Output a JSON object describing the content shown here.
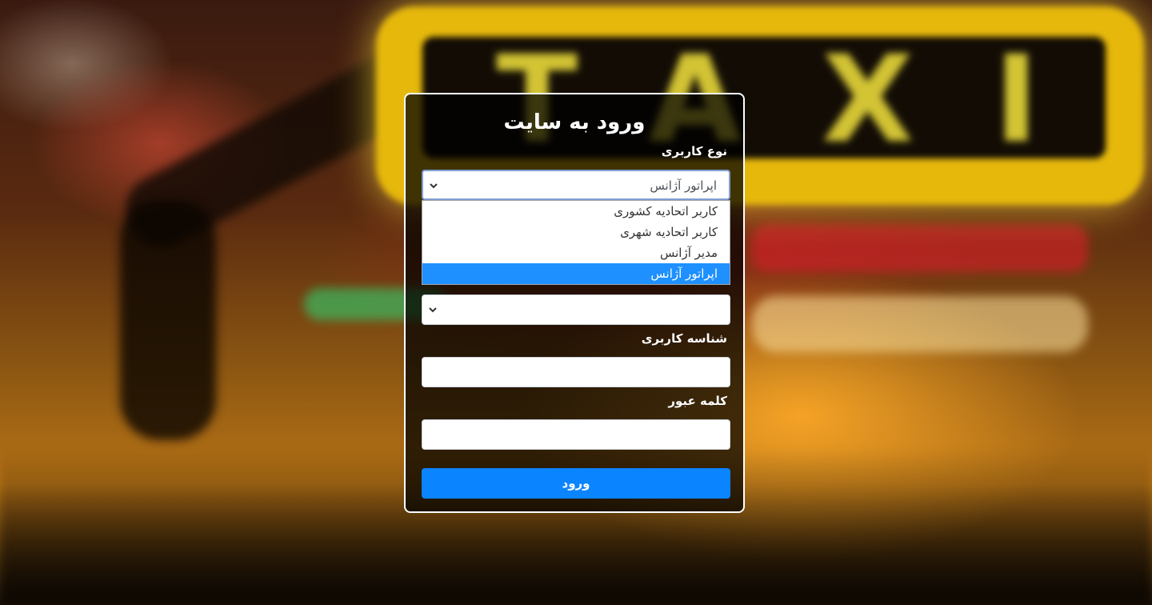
{
  "background": {
    "sign_text": "TAXI"
  },
  "login": {
    "title": "ورود به سایت",
    "user_type_label": "نوع کاربری",
    "user_type_value": "اپراتور آژانس",
    "user_type_options": [
      "کاربر اتحادیه کشوری",
      "کاربر اتحادیه شهری",
      "مدیر آژانس",
      "اپراتور آژانس"
    ],
    "second_select_value": "",
    "username_label": "شناسه کاربری",
    "username_value": "",
    "password_label": "کلمه عبور",
    "password_value": "",
    "submit_label": "ورود"
  },
  "colors": {
    "accent": "#0a84ff",
    "selected_option": "#1e90ff"
  }
}
